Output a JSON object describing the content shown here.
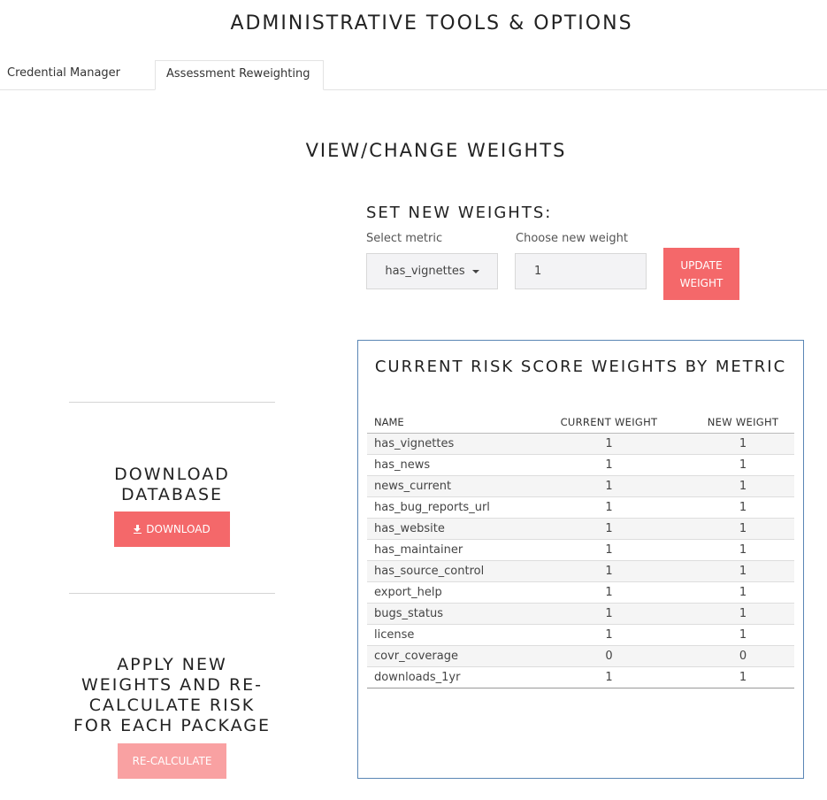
{
  "header": {
    "title": "ADMINISTRATIVE TOOLS & OPTIONS"
  },
  "tabs": [
    {
      "label": "Credential Manager",
      "active": false
    },
    {
      "label": "Assessment Reweighting",
      "active": true
    }
  ],
  "main": {
    "section_title": "VIEW/CHANGE WEIGHTS",
    "set_weights": {
      "title": "SET NEW WEIGHTS:",
      "metric_label": "Select metric",
      "metric_value": "has_vignettes",
      "weight_label": "Choose new weight",
      "weight_value": "1",
      "update_line1": "UPDATE",
      "update_line2": "WEIGHT"
    },
    "weights_table": {
      "title": "CURRENT RISK SCORE WEIGHTS BY METRIC",
      "headers": [
        "NAME",
        "CURRENT WEIGHT",
        "NEW WEIGHT"
      ],
      "rows": [
        [
          "has_vignettes",
          "1",
          "1"
        ],
        [
          "has_news",
          "1",
          "1"
        ],
        [
          "news_current",
          "1",
          "1"
        ],
        [
          "has_bug_reports_url",
          "1",
          "1"
        ],
        [
          "has_website",
          "1",
          "1"
        ],
        [
          "has_maintainer",
          "1",
          "1"
        ],
        [
          "has_source_control",
          "1",
          "1"
        ],
        [
          "export_help",
          "1",
          "1"
        ],
        [
          "bugs_status",
          "1",
          "1"
        ],
        [
          "license",
          "1",
          "1"
        ],
        [
          "covr_coverage",
          "0",
          "0"
        ],
        [
          "downloads_1yr",
          "1",
          "1"
        ]
      ]
    },
    "download": {
      "title": "DOWNLOAD DATABASE",
      "button_label": "DOWNLOAD",
      "icon": "download-icon"
    },
    "recalc": {
      "title": "APPLY NEW WEIGHTS AND RE-CALCULATE RISK FOR EACH PACKAGE",
      "button_label": "RE-CALCULATE"
    }
  },
  "colors": {
    "accent": "#f4686a",
    "accent_disabled": "#f9a1a2",
    "panel_border": "#5a86b5"
  }
}
